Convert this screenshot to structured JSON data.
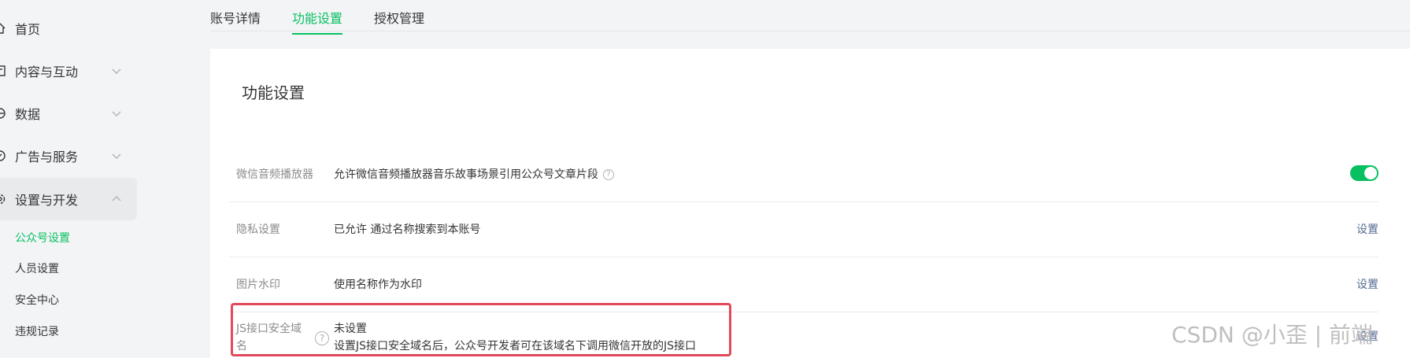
{
  "sidebar": {
    "items": [
      {
        "label": "首页",
        "icon": "home-icon"
      },
      {
        "label": "内容与互动",
        "icon": "content-icon"
      },
      {
        "label": "数据",
        "icon": "data-icon"
      },
      {
        "label": "广告与服务",
        "icon": "ad-icon"
      },
      {
        "label": "设置与开发",
        "icon": "settings-icon"
      }
    ],
    "sub_items": [
      "公众号设置",
      "人员设置",
      "安全中心",
      "违规记录"
    ]
  },
  "tabs": [
    "账号详情",
    "功能设置",
    "授权管理"
  ],
  "card": {
    "title": "功能设置",
    "rows": [
      {
        "label": "微信音频播放器",
        "value": "允许微信音频播放器音乐故事场景引用公众号文章片段",
        "help": "?"
      },
      {
        "label": "隐私设置",
        "value": "已允许 通过名称搜索到本账号",
        "action": "设置"
      },
      {
        "label": "图片水印",
        "value": "使用名称作为水印",
        "action": "设置"
      },
      {
        "label_line1": "JS接口安全域",
        "label_line2": "名",
        "help": "?",
        "value_line1": "未设置",
        "value_line2": "设置JS接口安全域名后，公众号开发者可在该域名下调用微信开放的JS接口",
        "action": "设置"
      }
    ]
  },
  "watermark": "CSDN @小歪 | 前端",
  "colors": {
    "accent": "#07c160",
    "link": "#576b95",
    "highlight": "#e24a5a"
  }
}
